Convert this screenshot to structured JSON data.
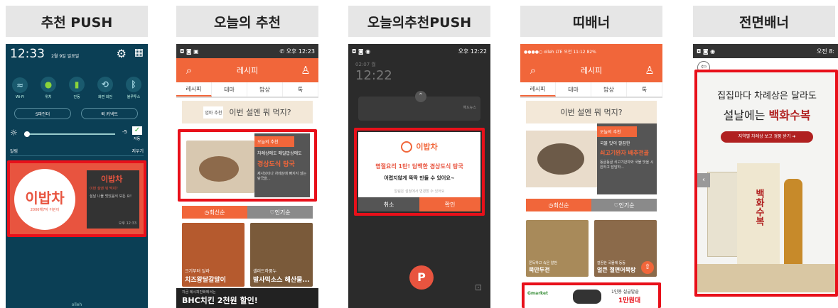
{
  "panels": [
    {
      "title": "추천 PUSH"
    },
    {
      "title": "오늘의 추천"
    },
    {
      "title": "오늘의추천PUSH"
    },
    {
      "title": "띠배너"
    },
    {
      "title": "전면배너"
    }
  ],
  "p1": {
    "time": "12:33",
    "date": "2월 9일 일요일",
    "toggles": [
      "Wi-Fi",
      "위치",
      "진동",
      "화면 회전",
      "블루투스"
    ],
    "btn1": "S파인더",
    "btn2": "퀵 커넥트",
    "brightness_val": "-5",
    "auto": "자동",
    "notif_left": "알림",
    "notif_right": "지우기",
    "logo": "이밥차",
    "logo_sub": "2006해7자 어린이",
    "notif_title": "이밥차",
    "notif_line1": "이번 설엔 뭐 먹지?",
    "notif_line2": "설날 나물 멋있음식 모든 요!",
    "notif_time": "오후 12:33",
    "carrier": "olleh"
  },
  "p2": {
    "status": "✆ 오후 12:23",
    "app_title": "레시피",
    "tabs": [
      "레시피",
      "테마",
      "밥상",
      "톡"
    ],
    "banner": "이번 설엔 뭐 먹지?",
    "banner_small": "엄마 추천",
    "rec_tag": "오늘의 추천",
    "rec_line1": "차례상에도 매일밥상에도",
    "rec_title": "경상도식 탕국",
    "rec_desc": "제사상이나 차례상에 빠지지 않는 탕국을...",
    "sort1": "최신순",
    "sort2": "인기순",
    "card1_pre": "크기부터 달라",
    "card1_title": "치즈왕달갈말이",
    "card2_pre": "샐러드하품누",
    "card2_title": "발사믹소스 해산물...",
    "bottom_pre": "지금 레시피만화에서는",
    "bottom_title": "BHC치킨 2천원 할인!"
  },
  "p3": {
    "time": "02:07 월",
    "clock": "12:22",
    "status": "오후 12:22",
    "news": "헤드뉴스",
    "logo": "이밥차",
    "title": "명절요리 1탄! 담백한 경상도식 탕국",
    "desc": "어렵지않게 뚝딱 만들 수 있어요~",
    "small": "알림은 설정에서 변경할 수 있어요",
    "cancel": "취소",
    "ok": "확인"
  },
  "p4": {
    "status": "●●●●○ olleh LTE   오전 11:12   82%",
    "app_title": "레시피",
    "tabs": [
      "레시피",
      "테마",
      "밥상",
      "톡"
    ],
    "banner": "이번 설엔 뭐 먹지?",
    "rec_tag": "오늘의 추천",
    "rec_line1": "국물 맛이 깔끔한",
    "rec_title": "쇠고기완자 배추전골",
    "rec_desc": "동글동글 쇠고기완자와 국물 맛을 시원하고 담담하...",
    "sort1": "최신순",
    "sort2": "인기순",
    "card1_pre": "쫀득하고 속은 알찬",
    "card1_title": "묵만두전",
    "card2_pre": "깔끔한 국물에 동동",
    "card2_title": "얼큰 절편어묵탕",
    "ad_brand": "Gmarket",
    "ad_text": "1인용 실글발솥",
    "ad_price": "1만원대"
  },
  "p5": {
    "status": "오전 8:",
    "line1": "집집마다 차례상은 달라도",
    "line2a": "설날에는 ",
    "line2b": "백화수복",
    "cta": "지역별 차례상 보고 경품 받기 ➜",
    "bottle_label": "백화수복"
  }
}
